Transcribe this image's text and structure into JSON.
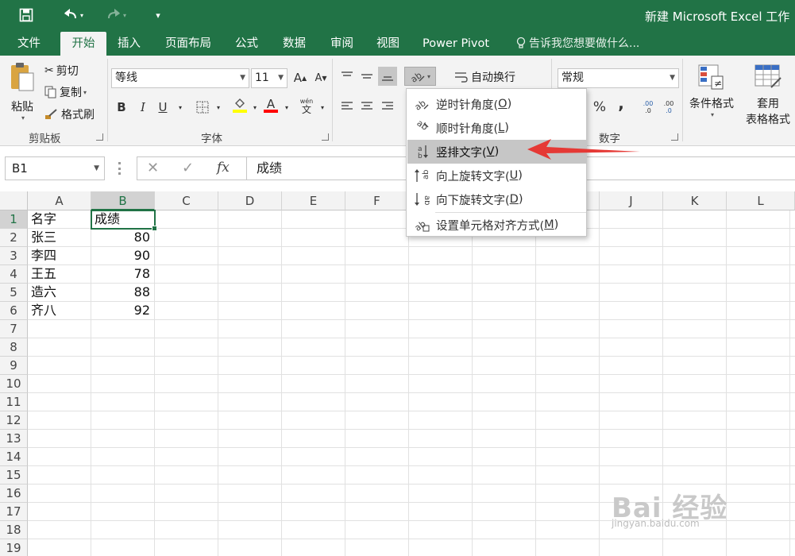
{
  "app": {
    "title": "新建 Microsoft Excel 工作",
    "brand_color": "#217346"
  },
  "quick_access": {
    "save_icon": "save-icon",
    "undo_icon": "undo-icon",
    "redo_icon": "redo-icon",
    "customize_icon": "customize-icon"
  },
  "tabs": [
    {
      "label": "文件"
    },
    {
      "label": "开始"
    },
    {
      "label": "插入"
    },
    {
      "label": "页面布局"
    },
    {
      "label": "公式"
    },
    {
      "label": "数据"
    },
    {
      "label": "审阅"
    },
    {
      "label": "视图"
    },
    {
      "label": "Power Pivot"
    }
  ],
  "active_tab": "开始",
  "tell_me": "告诉我您想要做什么...",
  "ribbon": {
    "clipboard": {
      "paste": "粘贴",
      "cut": "剪切",
      "copy": "复制",
      "format_painter": "格式刷",
      "group": "剪贴板"
    },
    "font": {
      "font_name": "等线",
      "font_size": "11",
      "bold": "B",
      "italic": "I",
      "underline": "U",
      "increase_size": "A",
      "decrease_size": "A",
      "fill_color": "#ffff00",
      "font_color": "#ff0000",
      "phonetic": "wén",
      "phonetic_char": "文",
      "group": "字体"
    },
    "alignment": {
      "wrap_text": "自动换行"
    },
    "number": {
      "format": "常规",
      "percent": "%",
      "comma": ",",
      "increase_decimal": ".00",
      "decrease_decimal": ".0",
      "group": "数字"
    },
    "styles": {
      "conditional_format": "条件格式",
      "table_format_1": "套用",
      "table_format_2": "表格格式"
    }
  },
  "orientation_menu": {
    "items": [
      {
        "label": "逆时针角度(",
        "key": "O",
        "suffix": ")",
        "icon": "counterclockwise-icon"
      },
      {
        "label": "顺时针角度(",
        "key": "L",
        "suffix": ")",
        "icon": "clockwise-icon"
      },
      {
        "label": "竖排文字(",
        "key": "V",
        "suffix": ")",
        "icon": "vertical-text-icon",
        "highlighted": true
      },
      {
        "label": "向上旋转文字(",
        "key": "U",
        "suffix": ")",
        "icon": "rotate-up-icon"
      },
      {
        "label": "向下旋转文字(",
        "key": "D",
        "suffix": ")",
        "icon": "rotate-down-icon"
      },
      {
        "label": "设置单元格对齐方式(",
        "key": "M",
        "suffix": ")",
        "icon": "format-alignment-icon"
      }
    ]
  },
  "formula_bar": {
    "name_box": "B1",
    "cancel": "✕",
    "enter": "✓",
    "fx": "fx",
    "content": "成绩"
  },
  "sheet": {
    "columns": [
      "A",
      "B",
      "C",
      "D",
      "E",
      "F",
      "G",
      "H",
      "I",
      "J",
      "K",
      "L"
    ],
    "rows": [
      "1",
      "2",
      "3",
      "4",
      "5",
      "6",
      "7",
      "8",
      "9",
      "10",
      "11",
      "12",
      "13",
      "14",
      "15",
      "16",
      "17",
      "18",
      "19"
    ],
    "selected_cell": "B1",
    "data": [
      [
        "名字",
        "成绩"
      ],
      [
        "张三",
        "80"
      ],
      [
        "李四",
        "90"
      ],
      [
        "王五",
        "78"
      ],
      [
        "造六",
        "88"
      ],
      [
        "齐八",
        "92"
      ]
    ]
  },
  "watermark": {
    "text": "Bai 经验",
    "url": "jingyan.baidu.com"
  },
  "annotation_color": "#e53935"
}
